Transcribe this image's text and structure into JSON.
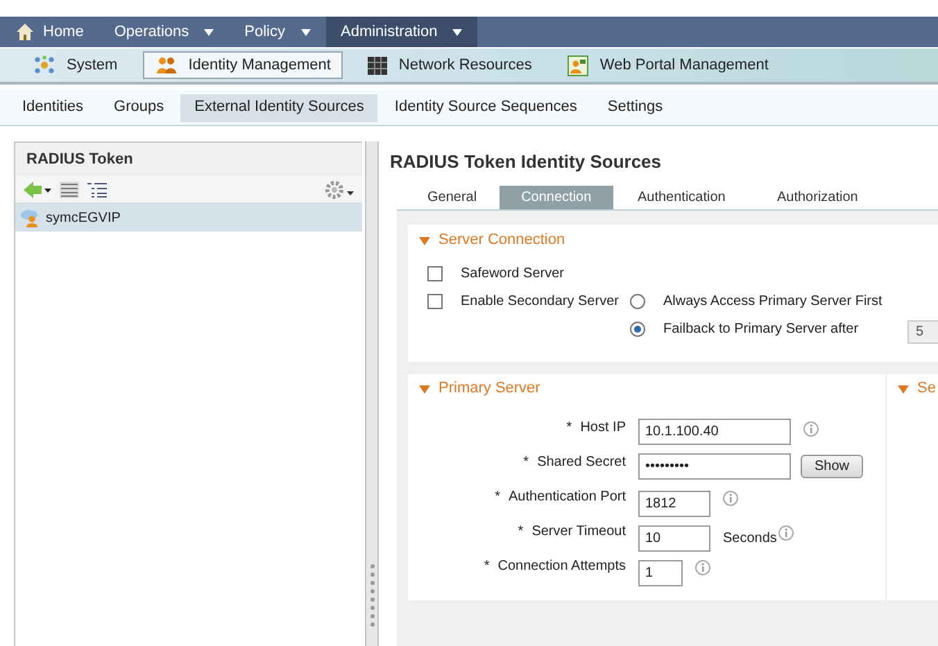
{
  "top_nav": [
    {
      "label": "Home",
      "has_menu": false,
      "selected": false
    },
    {
      "label": "Operations",
      "has_menu": true,
      "selected": false
    },
    {
      "label": "Policy",
      "has_menu": true,
      "selected": false
    },
    {
      "label": "Administration",
      "has_menu": true,
      "selected": true
    }
  ],
  "section_nav": [
    {
      "label": "System",
      "selected": false
    },
    {
      "label": "Identity Management",
      "selected": true
    },
    {
      "label": "Network Resources",
      "selected": false
    },
    {
      "label": "Web Portal Management",
      "selected": false
    }
  ],
  "sub_nav": [
    {
      "label": "Identities",
      "selected": false
    },
    {
      "label": "Groups",
      "selected": false
    },
    {
      "label": "External Identity Sources",
      "selected": true
    },
    {
      "label": "Identity Source Sequences",
      "selected": false
    },
    {
      "label": "Settings",
      "selected": false
    }
  ],
  "sidebar": {
    "title": "RADIUS Token",
    "items": [
      {
        "label": "symcEGVIP",
        "selected": true
      }
    ]
  },
  "page_title": "RADIUS Token Identity Sources",
  "tabs": [
    {
      "label": "General",
      "selected": false
    },
    {
      "label": "Connection",
      "selected": true
    },
    {
      "label": "Authentication",
      "selected": false
    },
    {
      "label": "Authorization",
      "selected": false
    }
  ],
  "server_connection": {
    "title": "Server Connection",
    "expanded": true,
    "checkboxes": [
      {
        "label": "Safeword Server",
        "checked": false
      },
      {
        "label": "Enable Secondary Server",
        "checked": false
      }
    ],
    "radios": [
      {
        "label": "Always Access Primary Server First",
        "selected": false
      },
      {
        "label": "Failback to Primary Server after",
        "selected": true
      }
    ],
    "failback_value": "5"
  },
  "primary_server": {
    "title": "Primary Server",
    "expanded": true,
    "fields": [
      {
        "required_mark": "*",
        "label": "Host IP",
        "value": "10.1.100.40",
        "info": true
      },
      {
        "required_mark": "*",
        "label": "Shared Secret",
        "value": "•••••••••",
        "info": false,
        "button": "Show"
      },
      {
        "required_mark": "*",
        "label": "Authentication Port",
        "value": "1812",
        "info": true
      },
      {
        "required_mark": "*",
        "label": "Server Timeout",
        "value": "10",
        "info": true,
        "suffix": "Seconds"
      },
      {
        "required_mark": "*",
        "label": "Connection Attempts",
        "value": "1",
        "info": true
      }
    ]
  },
  "secondary_server": {
    "title": "Se",
    "expanded": true
  }
}
